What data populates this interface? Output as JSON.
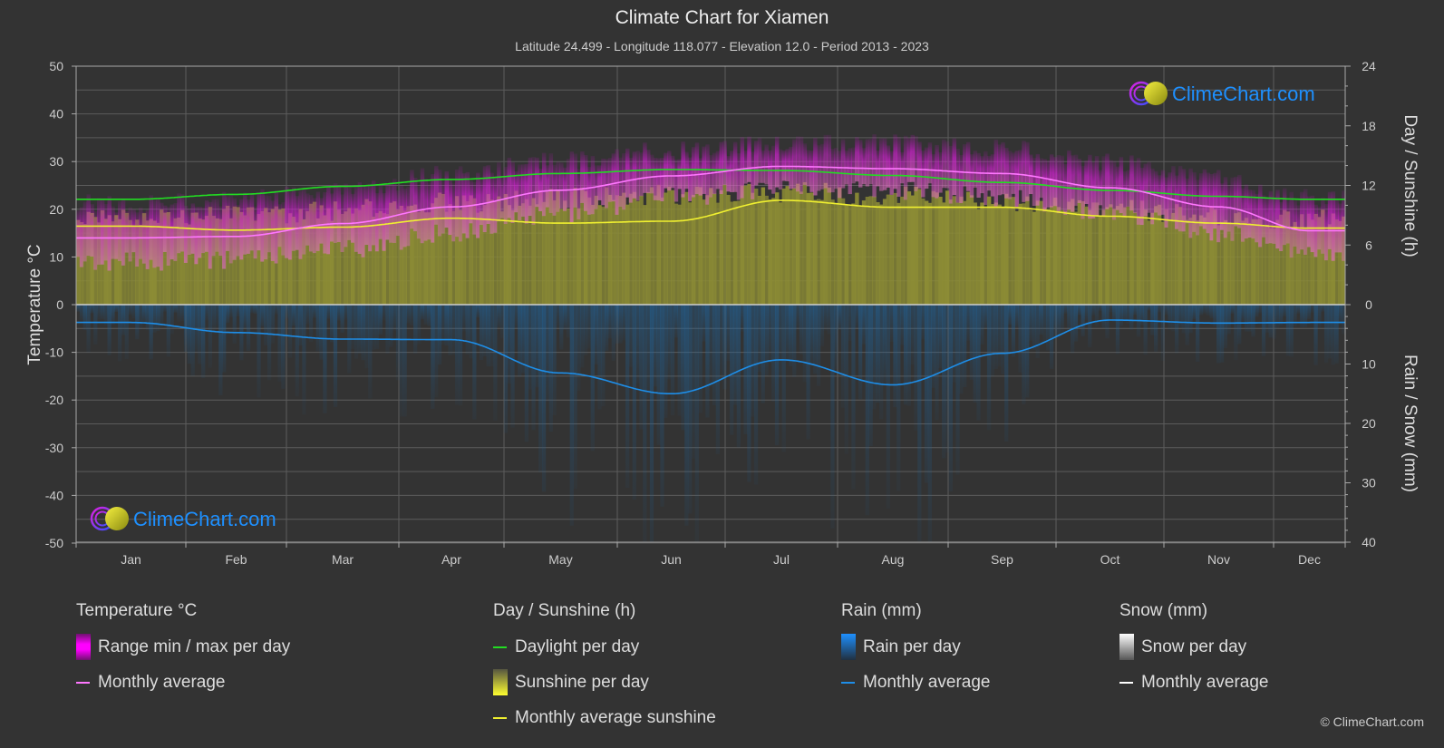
{
  "header": {
    "title": "Climate Chart for Xiamen",
    "subtitle": "Latitude 24.499 - Longitude 118.077 - Elevation 12.0 - Period 2013 - 2023"
  },
  "logo": {
    "text": "ClimeChart.com"
  },
  "copyright": "© ClimeChart.com",
  "colors": {
    "background": "#333333",
    "temp_range": "#d020d0",
    "temp_avg": "#ff77ff",
    "daylight": "#22dd22",
    "sunshine_fill": "#8c8c35",
    "sunshine_avg": "#f0f030",
    "rain_fill": "#1e5a8c",
    "rain_avg": "#1e8ee8",
    "snow_avg": "#ffffff",
    "logo_text": "#1e90ff"
  },
  "legend": {
    "temperature": {
      "heading": "Temperature °C",
      "items": [
        {
          "label": "Range min / max per day",
          "icon": "gradient-box-magenta"
        },
        {
          "label": "Monthly average",
          "icon": "line-pink"
        }
      ]
    },
    "sunshine": {
      "heading": "Day / Sunshine (h)",
      "items": [
        {
          "label": "Daylight per day",
          "icon": "line-green"
        },
        {
          "label": "Sunshine per day",
          "icon": "gradient-box-yellow"
        },
        {
          "label": "Monthly average sunshine",
          "icon": "line-yellow"
        }
      ]
    },
    "rain": {
      "heading": "Rain (mm)",
      "items": [
        {
          "label": "Rain per day",
          "icon": "gradient-box-blue"
        },
        {
          "label": "Monthly average",
          "icon": "line-blue"
        }
      ]
    },
    "snow": {
      "heading": "Snow (mm)",
      "items": [
        {
          "label": "Snow per day",
          "icon": "gradient-box-white"
        },
        {
          "label": "Monthly average",
          "icon": "line-white"
        }
      ]
    }
  },
  "chart_data": {
    "type": "line",
    "title": "Climate Chart for Xiamen",
    "categories": [
      "Jan",
      "Feb",
      "Mar",
      "Apr",
      "May",
      "Jun",
      "Jul",
      "Aug",
      "Sep",
      "Oct",
      "Nov",
      "Dec"
    ],
    "axes": {
      "left": {
        "label": "Temperature °C",
        "range": [
          -50,
          50
        ],
        "ticks": [
          50,
          40,
          30,
          20,
          10,
          0,
          -10,
          -20,
          -30,
          -40,
          -50
        ]
      },
      "right_top": {
        "label": "Day / Sunshine (h)",
        "range": [
          0,
          24
        ],
        "ticks": [
          24,
          18,
          12,
          6,
          0
        ]
      },
      "right_bottom": {
        "label": "Rain / Snow (mm)",
        "range": [
          0,
          40
        ],
        "ticks": [
          10,
          20,
          30,
          40
        ]
      }
    },
    "grid": true,
    "series": [
      {
        "name": "Temperature monthly average",
        "axis": "left",
        "unit": "°C",
        "values": [
          14.0,
          14.3,
          17.0,
          20.5,
          24.0,
          27.0,
          29.0,
          28.5,
          27.5,
          24.5,
          20.5,
          15.5
        ]
      },
      {
        "name": "Temperature daily max (approx. upper range)",
        "axis": "left",
        "unit": "°C",
        "values": [
          20.5,
          21.5,
          23.5,
          26.5,
          29.5,
          31.5,
          33.0,
          33.0,
          32.0,
          29.0,
          26.0,
          21.5
        ]
      },
      {
        "name": "Temperature daily min (approx. lower range)",
        "axis": "left",
        "unit": "°C",
        "values": [
          11.0,
          11.5,
          13.5,
          17.0,
          21.0,
          24.5,
          26.0,
          26.0,
          24.5,
          21.0,
          17.0,
          12.5
        ]
      },
      {
        "name": "Daylight per day",
        "axis": "right_top",
        "unit": "h",
        "values": [
          10.6,
          11.1,
          11.9,
          12.6,
          13.2,
          13.6,
          13.5,
          13.0,
          12.3,
          11.5,
          10.9,
          10.6
        ]
      },
      {
        "name": "Sunshine per day (upper extent)",
        "axis": "right_top",
        "unit": "h",
        "values": [
          9.6,
          10.0,
          10.6,
          11.3,
          11.8,
          12.2,
          12.4,
          12.0,
          11.4,
          10.6,
          10.0,
          9.6
        ]
      },
      {
        "name": "Monthly average sunshine",
        "axis": "right_top",
        "unit": "h",
        "values": [
          7.9,
          7.5,
          7.8,
          8.7,
          8.2,
          8.4,
          10.5,
          9.8,
          9.8,
          8.9,
          8.2,
          7.7
        ]
      },
      {
        "name": "Rain monthly average",
        "axis": "right_bottom",
        "unit": "mm",
        "values": [
          3.0,
          4.7,
          5.8,
          5.9,
          11.5,
          15.0,
          9.3,
          13.5,
          8.2,
          2.6,
          3.1,
          3.0
        ]
      },
      {
        "name": "Snow monthly average",
        "axis": "right_bottom",
        "unit": "mm",
        "values": [
          0,
          0,
          0,
          0,
          0,
          0,
          0,
          0,
          0,
          0,
          0,
          0
        ]
      }
    ]
  }
}
